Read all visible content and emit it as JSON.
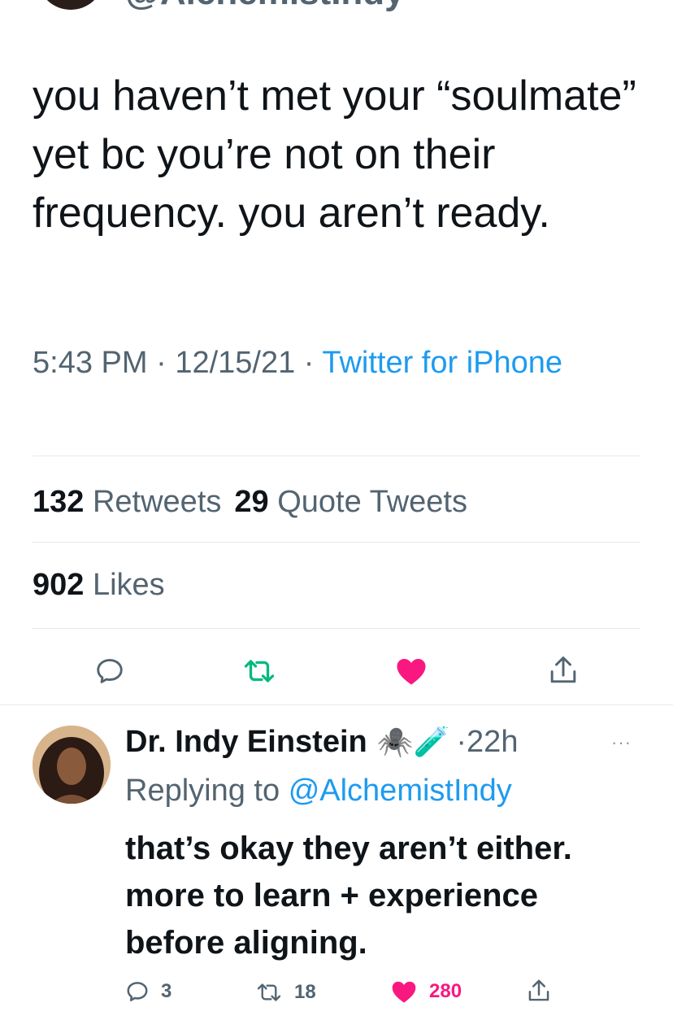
{
  "top_handle": "@AlchemistIndy",
  "tweet": {
    "text": "you haven’t met your “soulmate” yet bc you’re not on their frequency. you aren’t ready.",
    "time": "5:43 PM",
    "date": "12/15/21",
    "source": "Twitter for iPhone",
    "retweets_count": "132",
    "retweets_label": "Retweets",
    "quotes_count": "29",
    "quotes_label": "Quote Tweets",
    "likes_count": "902",
    "likes_label": "Likes",
    "actions": [
      "reply-icon",
      "retweet-icon",
      "heart-icon",
      "share-icon"
    ]
  },
  "reply": {
    "name": "Dr. Indy Einstein",
    "emojis": "🕷️🧪",
    "time": "·22h",
    "replying_prefix": "Replying to",
    "replying_handle": "@AlchemistIndy",
    "text": "that’s okay they aren’t either. more to learn + experience before aligning.",
    "reply_count": "3",
    "retweet_count": "18",
    "like_count": "280",
    "more_icon": "···"
  },
  "colors": {
    "accent": "#1d9bf0",
    "like": "#f91880",
    "retweet": "#00ba7c",
    "secondary_text": "#536471"
  }
}
